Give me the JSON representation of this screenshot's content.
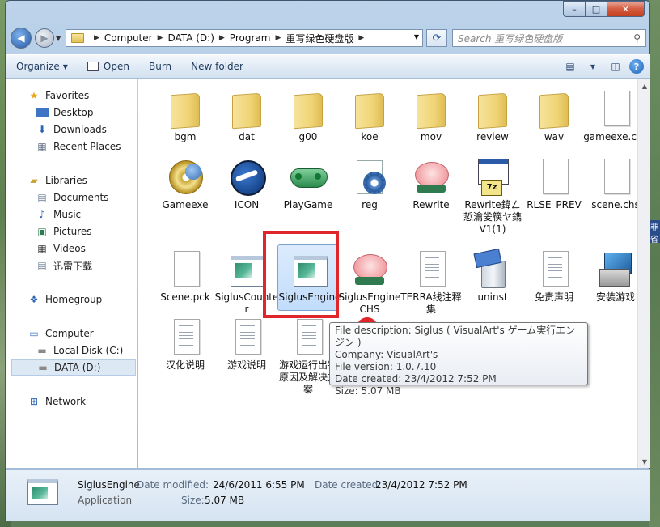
{
  "window": {
    "caption": {
      "minimize": "–",
      "maximize": "□",
      "close": "✕"
    }
  },
  "address": {
    "crumbs": [
      "Computer",
      "DATA (D:)",
      "Program",
      "重写绿色硬盘版"
    ]
  },
  "search": {
    "placeholder": "Search 重写绿色硬盘版"
  },
  "toolbar": {
    "organize": "Organize",
    "open": "Open",
    "burn": "Burn",
    "new_folder": "New folder"
  },
  "navpane": {
    "favorites": "Favorites",
    "desktop": "Desktop",
    "downloads": "Downloads",
    "recent": "Recent Places",
    "libraries": "Libraries",
    "documents": "Documents",
    "music": "Music",
    "pictures": "Pictures",
    "videos": "Videos",
    "xunlei": "迅雷下载",
    "homegroup": "Homegroup",
    "computer": "Computer",
    "local_disk": "Local Disk (C:)",
    "data_disk": "DATA (D:)",
    "network": "Network"
  },
  "files": [
    {
      "label": "bgm",
      "icon": "folder-icon"
    },
    {
      "label": "dat",
      "icon": "folder-icon"
    },
    {
      "label": "g00",
      "icon": "folder-icon"
    },
    {
      "label": "koe",
      "icon": "folder-icon"
    },
    {
      "label": "mov",
      "icon": "folder-icon"
    },
    {
      "label": "review",
      "icon": "folder-icon"
    },
    {
      "label": "wav",
      "icon": "folder-icon"
    },
    {
      "label": "gameexe.chs",
      "icon": "document-icon"
    },
    {
      "label": "Gameexe",
      "icon": "disc-icon"
    },
    {
      "label": "ICON",
      "icon": "logo-icon"
    },
    {
      "label": "PlayGame",
      "icon": "gamepad-icon"
    },
    {
      "label": "reg",
      "icon": "registry-icon"
    },
    {
      "label": "Rewrite",
      "icon": "rewrite-icon"
    },
    {
      "label": "Rewrite鍏ㄥ悊瀹夎筷ヤ鐫V1(1)",
      "icon": "installer-icon"
    },
    {
      "label": "RLSE_PREV",
      "icon": "document-icon"
    },
    {
      "label": "scene.chs",
      "icon": "document-icon"
    },
    {
      "label": "Scene.pck",
      "icon": "document-icon"
    },
    {
      "label": "SiglusCounter",
      "icon": "application-icon"
    },
    {
      "label": "SiglusEngine",
      "icon": "application-icon"
    },
    {
      "label": "SiglusEngineCHS",
      "icon": "rewrite-icon"
    },
    {
      "label": "TERRA线注释集",
      "icon": "text-document-icon"
    },
    {
      "label": "uninst",
      "icon": "uninstall-icon"
    },
    {
      "label": "免责声明",
      "icon": "text-document-icon"
    },
    {
      "label": "安装游戏",
      "icon": "setup-icon"
    },
    {
      "label": "汉化说明",
      "icon": "text-document-icon"
    },
    {
      "label": "游戏说明",
      "icon": "text-document-icon"
    },
    {
      "label": "游戏运行出错原因及解决方案",
      "icon": "text-document-icon"
    }
  ],
  "tooltip": {
    "line1": "File description: Siglus ( VisualArt's ゲーム実行エンジン )",
    "line2": "Company: VisualArt's",
    "line3": "File version: 1.0.7.10",
    "line4": "Date created: 23/4/2012 7:52 PM",
    "line5": "Size: 5.07 MB"
  },
  "details": {
    "name": "SiglusEngine",
    "type": "Application",
    "modified_label": "Date modified:",
    "modified_value": "24/6/2011 6:55 PM",
    "size_label": "Size:",
    "size_value": "5.07 MB",
    "created_label": "Date created:",
    "created_value": "23/4/2012 7:52 PM"
  },
  "side_text": "非省",
  "colors": {
    "highlight": "#e0262a",
    "selection": "#c1dcfc"
  }
}
